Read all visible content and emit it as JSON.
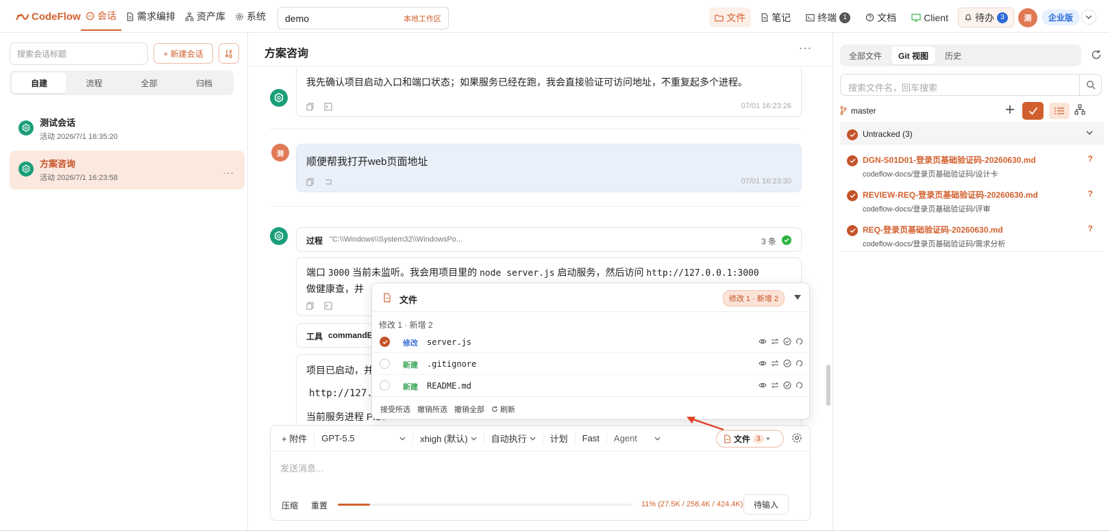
{
  "app": {
    "logo": "CodeFlow",
    "nav": [
      "会话",
      "需求编排",
      "资产库",
      "系统"
    ],
    "workspace": {
      "name": "demo",
      "tag": "本地工作区"
    },
    "right_nav": {
      "files": "文件",
      "notes": "笔记",
      "terminal": "终端",
      "terminal_count": "1",
      "docs": "文档",
      "client": "Client",
      "todo": "待办",
      "todo_count": "3",
      "avatar": "测",
      "edition": "企业版"
    }
  },
  "sidebar": {
    "search_placeholder": "搜索会话标题",
    "new_button": "+ 新建会话",
    "tabs": [
      "自建",
      "流程",
      "全部",
      "归档"
    ],
    "sessions": [
      {
        "title": "测试会话",
        "subtitle": "活动 2026/7/1 16:35:20"
      },
      {
        "title": "方案咨询",
        "subtitle": "活动 2026/7/1 16:23:58",
        "more": "···"
      }
    ]
  },
  "chat": {
    "title": "方案咨询",
    "more": "···",
    "messages": [
      {
        "text": "我先确认项目启动入口和端口状态；如果服务已经在跑，我会直接验证可访问地址，不重复起多个进程。",
        "time": "07/01 16:23:26"
      },
      {
        "avatar": "测",
        "text": "顺便帮我打开web页面地址",
        "time": "07/01 16:23:30"
      }
    ],
    "process": {
      "label": "过程",
      "command": "\"C:\\\\Windows\\\\System32\\\\WindowsPo...",
      "count": "3 条"
    },
    "reply": {
      "line1": [
        "端口 ",
        "3000",
        " 当前未监听。我会用项目里的 ",
        "node server.js",
        " 启动服务，然后访问 ",
        "http://127.0.0.1:3000"
      ],
      "line2": "做健康查，并"
    },
    "tool": {
      "label": "工具",
      "name": "commandE"
    },
    "final": {
      "line1": "项目已启动，并",
      "line2": "http://127.0",
      "line3": "当前服务进程 PID:"
    }
  },
  "composer": {
    "attach": "+ 附件",
    "model": "GPT-5.5",
    "reasoning": "xhigh (默认)",
    "mode": "自动执行",
    "plan": "计划",
    "fast": "Fast",
    "agent": "Agent",
    "file_chip": "文件",
    "file_count": "3",
    "placeholder": "发送消息...",
    "compress": "压缩",
    "reset": "重置",
    "progress_text": "11% (27.5K / 258.4K / 424.4K)",
    "progress_value": 0.11,
    "queue": "待输入"
  },
  "file_popup": {
    "title": "文件",
    "tag": "修改 1 · 新增 2",
    "subtitle": "修改 1 · 新增 2",
    "files": [
      {
        "status": "修改",
        "name": "server.js",
        "checked": true,
        "color": "#3b6fd6"
      },
      {
        "status": "新建",
        "name": ".gitignore",
        "checked": false,
        "color": "#3aa655"
      },
      {
        "status": "新建",
        "name": "README.md",
        "checked": false,
        "color": "#3aa655"
      }
    ],
    "actions": [
      "接受所选",
      "撤销所选",
      "撤销全部",
      "刷新"
    ]
  },
  "right_panel": {
    "tabs": [
      "全部文件",
      "Git 视图",
      "历史"
    ],
    "search_placeholder": "搜索文件名，回车搜索",
    "branch": "master",
    "group": "Untracked (3)",
    "files": [
      {
        "name": "DGN-S01D01-登录页基础验证码-20260630.md",
        "path": "codeflow-docs/登录页基础验证码/设计卡",
        "flag": "?"
      },
      {
        "name": "REVIEW-REQ-登录页基础验证码-20260630.md",
        "path": "codeflow-docs/登录页基础验证码/评审",
        "flag": "?"
      },
      {
        "name": "REQ-登录页基础验证码-20260630.md",
        "path": "codeflow-docs/登录页基础验证码/需求分析",
        "flag": "?"
      }
    ]
  },
  "colors": {
    "accent": "#d2602e",
    "badge_blue": "#2d6bd8",
    "success": "#2fb344"
  }
}
